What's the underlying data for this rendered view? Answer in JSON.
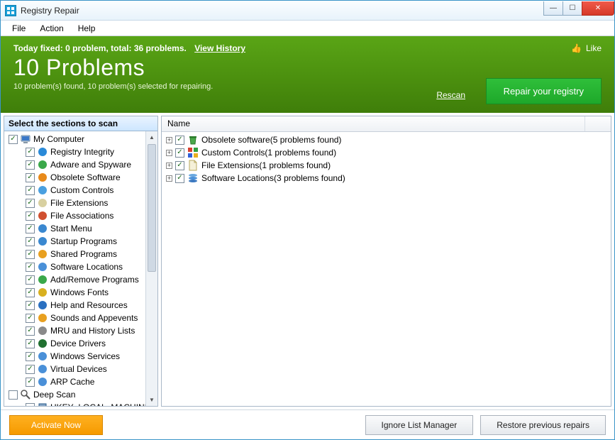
{
  "window": {
    "title": "Registry Repair"
  },
  "menu": {
    "file": "File",
    "action": "Action",
    "help": "Help"
  },
  "header": {
    "status_prefix": "Today fixed: ",
    "fixed_count": "0 problem",
    "status_mid": ", total: ",
    "total_count": "36 problems.",
    "view_history": "View History",
    "big_title": "10 Problems",
    "subtitle": "10 problem(s) found, 10 problem(s) selected for repairing.",
    "like": "Like",
    "rescan": "Rescan",
    "repair": "Repair your registry"
  },
  "left": {
    "header": "Select the sections to scan",
    "root": "My Computer",
    "items": [
      "Registry Integrity",
      "Adware and Spyware",
      "Obsolete Software",
      "Custom Controls",
      "File Extensions",
      "File Associations",
      "Start Menu",
      "Startup Programs",
      "Shared Programs",
      "Software Locations",
      "Add/Remove Programs",
      "Windows Fonts",
      "Help and Resources",
      "Sounds and Appevents",
      "MRU and History Lists",
      "Device Drivers",
      "Windows Services",
      "Virtual Devices",
      "ARP Cache"
    ],
    "root2": "Deep Scan",
    "root2_child": "HKEY_LOCAL_MACHINE"
  },
  "right": {
    "col_name": "Name",
    "results": [
      {
        "label": "Obsolete software(5 problems found)",
        "icon": "trash"
      },
      {
        "label": "Custom Controls(1 problems found)",
        "icon": "controls"
      },
      {
        "label": "File Extensions(1 problems found)",
        "icon": "file"
      },
      {
        "label": "Software Locations(3 problems found)",
        "icon": "disks"
      }
    ]
  },
  "footer": {
    "activate": "Activate Now",
    "ignore": "Ignore List Manager",
    "restore": "Restore previous repairs"
  },
  "icon_colors": [
    "#2a8ad8",
    "#3aa84a",
    "#e88a1a",
    "#4aa0e0",
    "#d8d0a0",
    "#d05030",
    "#3a88d0",
    "#3a88d0",
    "#e8a020",
    "#4a90d8",
    "#3aa84a",
    "#d8b020",
    "#2a70c0",
    "#e8a020",
    "#8a8a8a",
    "#207030",
    "#4a90d8",
    "#4a90d8",
    "#4a90d8"
  ]
}
